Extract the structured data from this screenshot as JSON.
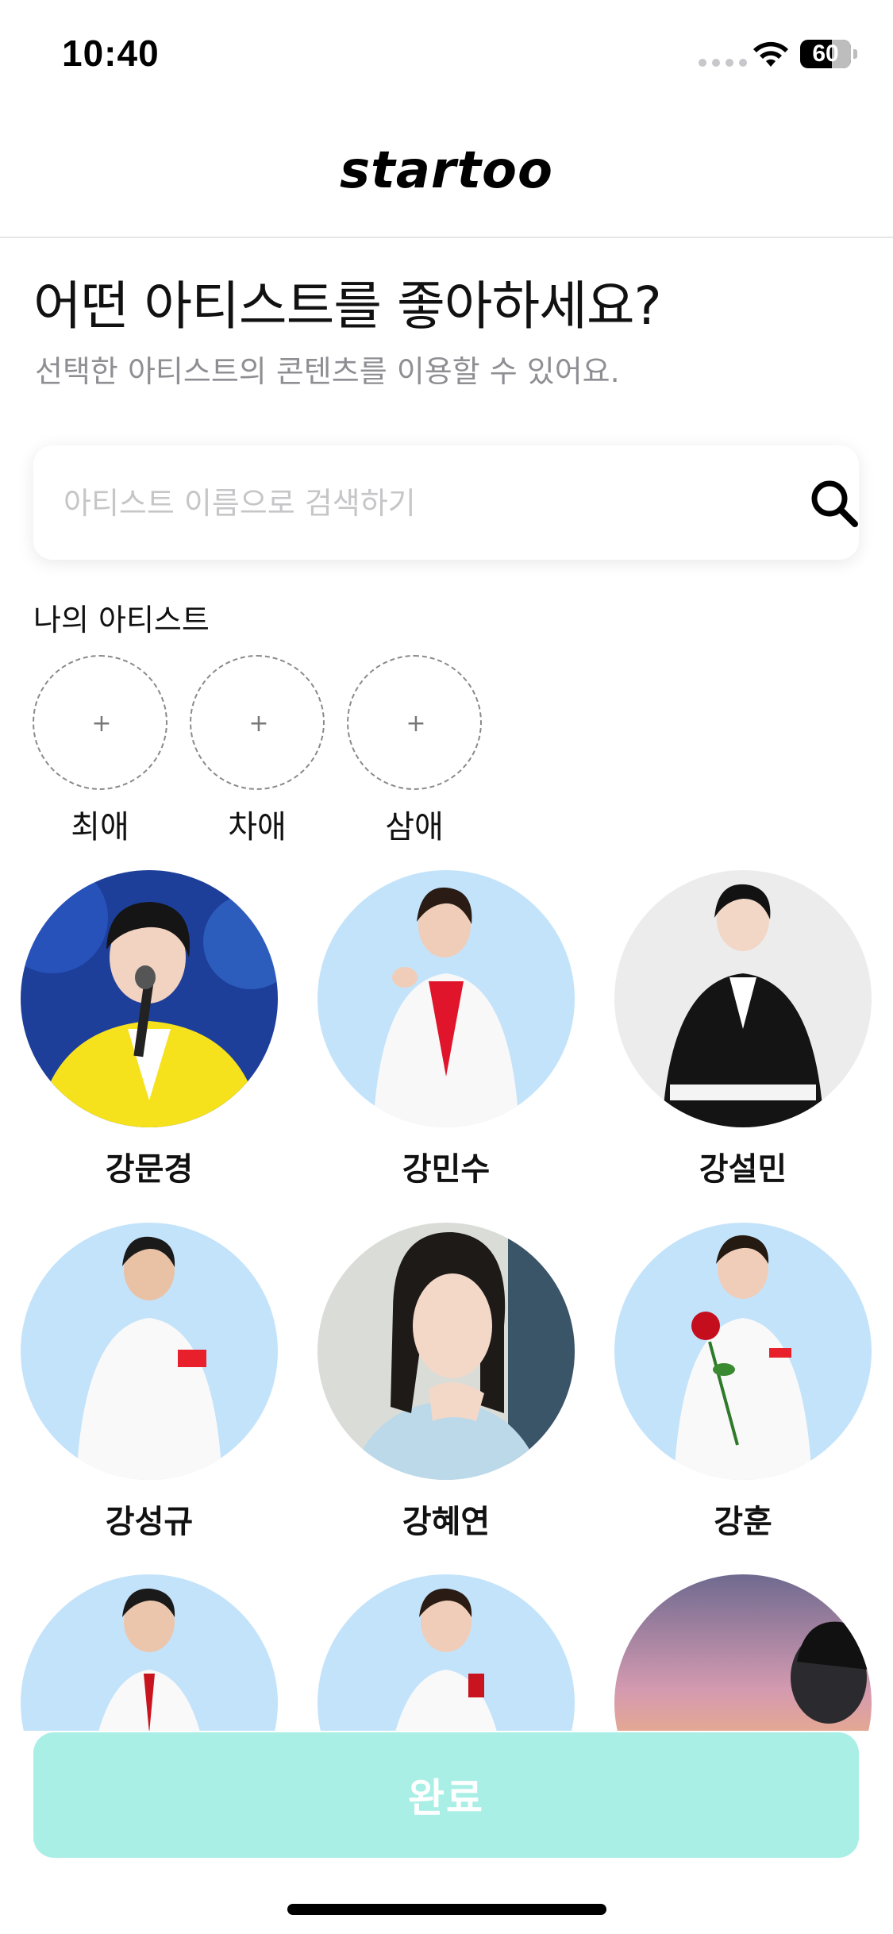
{
  "status_bar": {
    "time": "10:40",
    "battery": "60"
  },
  "header": {
    "logo": "startoo"
  },
  "intro": {
    "title": "어떤 아티스트를 좋아하세요?",
    "subtitle": "선택한 아티스트의 콘텐츠를 이용할 수 있어요."
  },
  "search": {
    "placeholder": "아티스트 이름으로 검색하기",
    "value": ""
  },
  "my_artists": {
    "label": "나의 아티스트",
    "slots": [
      {
        "label": "최애",
        "icon": "plus-icon"
      },
      {
        "label": "차애",
        "icon": "plus-icon"
      },
      {
        "label": "삼애",
        "icon": "plus-icon"
      }
    ]
  },
  "artists": [
    {
      "name": "강문경"
    },
    {
      "name": "강민수"
    },
    {
      "name": "강설민"
    },
    {
      "name": "강성규"
    },
    {
      "name": "강혜연"
    },
    {
      "name": "강훈"
    },
    {
      "name": ""
    },
    {
      "name": ""
    },
    {
      "name": ""
    }
  ],
  "footer": {
    "done_label": "완료"
  },
  "colors": {
    "accent": "#a9efe6",
    "avatar_bg": "#c3e3fb",
    "muted_text": "#8e8e93"
  }
}
